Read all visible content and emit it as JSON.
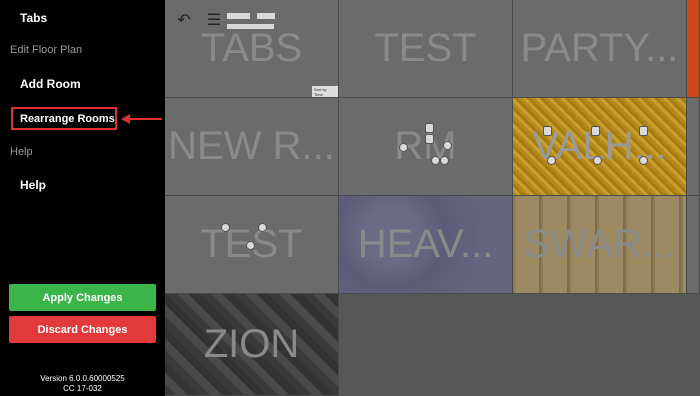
{
  "sidebar": {
    "tabs_label": "Tabs",
    "section_edit": "Edit Floor Plan",
    "add_room": "Add Room",
    "rearrange_rooms": "Rearrange Rooms",
    "section_help": "Help",
    "help": "Help",
    "apply_changes": "Apply Changes",
    "discard_changes": "Discard Changes",
    "version": "Version 6.0.0.60000525",
    "build": "CC 17-032"
  },
  "rooms": [
    {
      "name": "TABS"
    },
    {
      "name": "TEST"
    },
    {
      "name": "PARTY..."
    },
    {
      "name": "NEW R..."
    },
    {
      "name": "RM"
    },
    {
      "name": "VALH..."
    },
    {
      "name": "TEST"
    },
    {
      "name": "HEAV..."
    },
    {
      "name": "SWAR..."
    },
    {
      "name": "ZION"
    }
  ],
  "tile_misc": {
    "sort_tag": "Sort by Time"
  },
  "colors": {
    "highlight": "#e03030",
    "apply": "#3bb54a",
    "discard": "#e23a3a"
  },
  "icons": {
    "back": "back-arrow-icon",
    "menu": "hamburger-menu-icon"
  }
}
